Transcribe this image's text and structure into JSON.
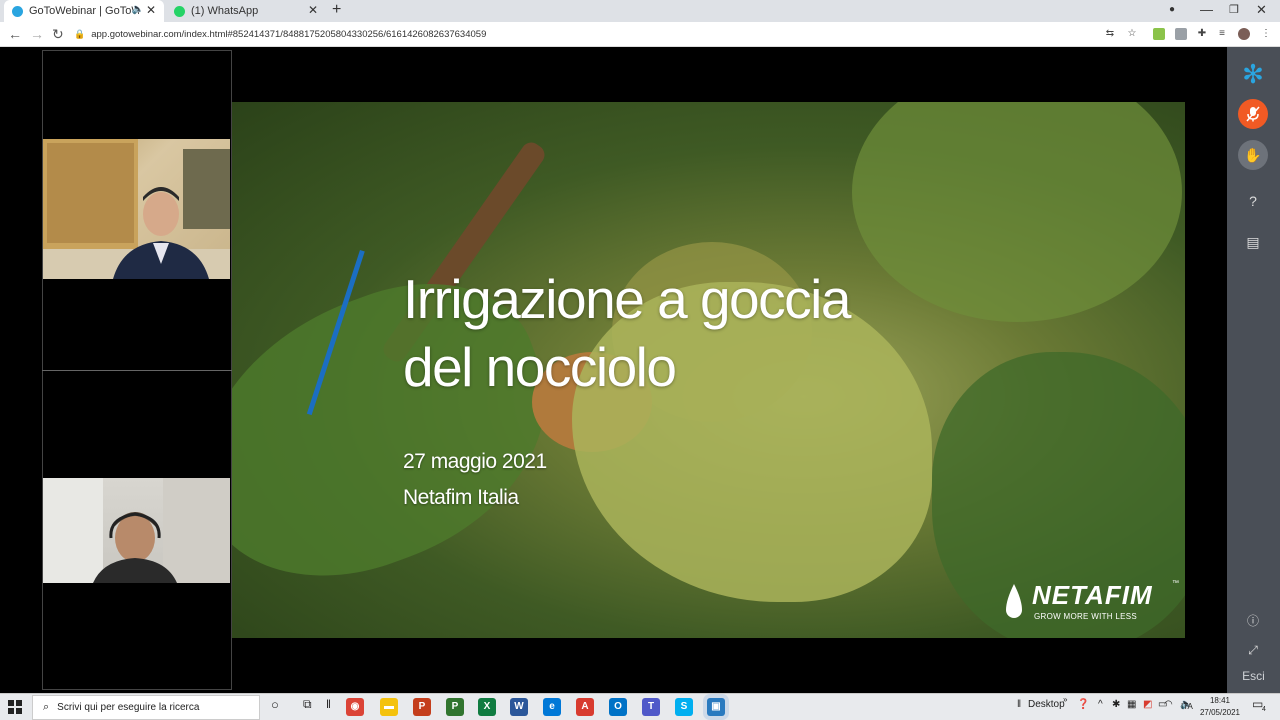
{
  "browser": {
    "tabs": [
      {
        "title": "GoToWebinar | GoToWebinar",
        "active": true,
        "favicon_color": "#2aa5e0",
        "icon": "speaker-icon"
      },
      {
        "title": "(1) WhatsApp",
        "active": false,
        "favicon_color": "#25d366"
      }
    ],
    "new_tab": "+",
    "url": "app.gotowebinar.com/index.html#852414371/8488175205804330256/6161426082637634059"
  },
  "slide": {
    "title_line1": "Irrigazione a goccia",
    "title_line2": "del nocciolo",
    "date": "27 maggio 2021",
    "organization": "Netafim Italia",
    "logo_name": "NETAFIM",
    "logo_tm": "™",
    "logo_tagline": "GROW MORE WITH LESS",
    "accent_color": "#1b6ec2"
  },
  "sidebar": {
    "exit_label": "Esci",
    "mic_color": "#f15a24"
  },
  "taskbar": {
    "search_placeholder": "Scrivi qui per eseguire la ricerca",
    "desktop_label": "Desktop",
    "language": "ITA",
    "time": "18:41",
    "date": "27/05/2021",
    "notification_count": "4",
    "apps": [
      {
        "name": "chrome",
        "label": "◉",
        "color": "#db4437"
      },
      {
        "name": "file-explorer",
        "label": "▬",
        "color": "#f4c20d"
      },
      {
        "name": "powerpoint",
        "label": "P",
        "color": "#c43e1c"
      },
      {
        "name": "project",
        "label": "P",
        "color": "#31752f"
      },
      {
        "name": "excel",
        "label": "X",
        "color": "#107c41"
      },
      {
        "name": "word",
        "label": "W",
        "color": "#2b579a"
      },
      {
        "name": "edge",
        "label": "e",
        "color": "#0078d7"
      },
      {
        "name": "acrobat",
        "label": "A",
        "color": "#d83b2f"
      },
      {
        "name": "outlook",
        "label": "O",
        "color": "#0072c6"
      },
      {
        "name": "teams",
        "label": "T",
        "color": "#5059c9"
      },
      {
        "name": "skype",
        "label": "S",
        "color": "#00aff0"
      },
      {
        "name": "gotowebinar-app",
        "label": "▣",
        "color": "#2a7abf"
      }
    ]
  }
}
